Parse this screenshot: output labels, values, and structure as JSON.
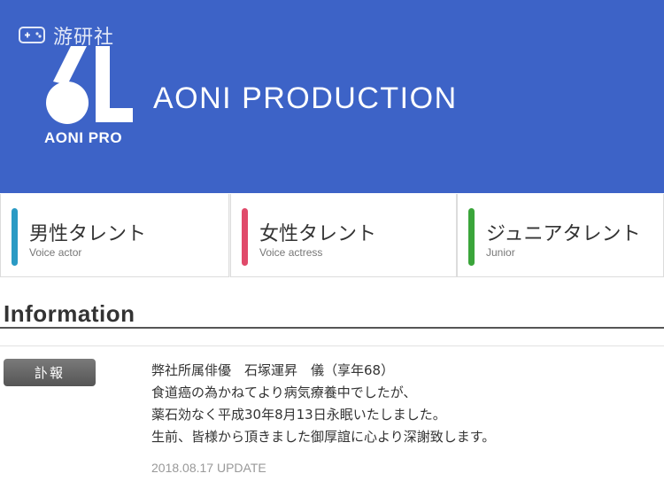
{
  "watermark": {
    "text": "游研社",
    "icon": "gamepad-icon"
  },
  "brand": {
    "logo_icon": "aoni-logo-icon",
    "logo_text": "AONI PRO",
    "name": "AONI PRODUCTION",
    "color": "#3d63c7"
  },
  "nav": [
    {
      "title": "男性タレント",
      "subtitle": "Voice actor",
      "color": "#2a9ac4"
    },
    {
      "title": "女性タレント",
      "subtitle": "Voice actress",
      "color": "#e04a6a"
    },
    {
      "title": "ジュニアタレント",
      "subtitle": "Junior",
      "color": "#3aa53a"
    }
  ],
  "information": {
    "heading": "Information",
    "badge": "訃報",
    "lines": [
      "弊社所属俳優　石塚運昇　儀（享年68）",
      "食道癌の為かねてより病気療養中でしたが、",
      "薬石効なく平成30年8月13日永眠いたしました。",
      "生前、皆様から頂きました御厚誼に心より深謝致します。"
    ],
    "update": "2018.08.17 UPDATE"
  }
}
